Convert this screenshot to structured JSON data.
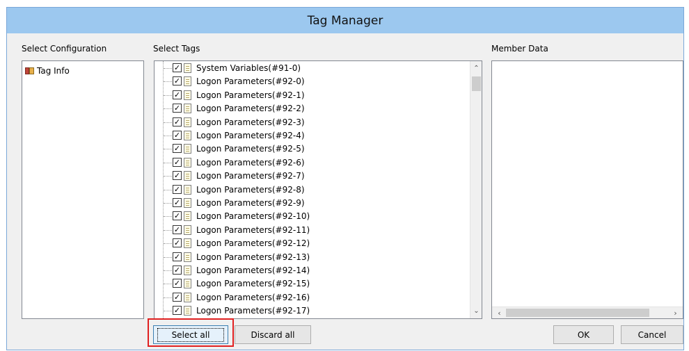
{
  "window": {
    "title": "Tag Manager"
  },
  "labels": {
    "select_configuration": "Select Configuration",
    "select_tags": "Select Tags",
    "member_data": "Member Data"
  },
  "configuration": {
    "items": [
      {
        "label": "Tag Info",
        "icon": "book-icon"
      }
    ]
  },
  "tags": {
    "items": [
      {
        "label": "System Variables(#91-0)",
        "checked": true
      },
      {
        "label": "Logon Parameters(#92-0)",
        "checked": true
      },
      {
        "label": "Logon Parameters(#92-1)",
        "checked": true
      },
      {
        "label": "Logon Parameters(#92-2)",
        "checked": true
      },
      {
        "label": "Logon Parameters(#92-3)",
        "checked": true
      },
      {
        "label": "Logon Parameters(#92-4)",
        "checked": true
      },
      {
        "label": "Logon Parameters(#92-5)",
        "checked": true
      },
      {
        "label": "Logon Parameters(#92-6)",
        "checked": true
      },
      {
        "label": "Logon Parameters(#92-7)",
        "checked": true
      },
      {
        "label": "Logon Parameters(#92-8)",
        "checked": true
      },
      {
        "label": "Logon Parameters(#92-9)",
        "checked": true
      },
      {
        "label": "Logon Parameters(#92-10)",
        "checked": true
      },
      {
        "label": "Logon Parameters(#92-11)",
        "checked": true
      },
      {
        "label": "Logon Parameters(#92-12)",
        "checked": true
      },
      {
        "label": "Logon Parameters(#92-13)",
        "checked": true
      },
      {
        "label": "Logon Parameters(#92-14)",
        "checked": true
      },
      {
        "label": "Logon Parameters(#92-15)",
        "checked": true
      },
      {
        "label": "Logon Parameters(#92-16)",
        "checked": true
      },
      {
        "label": "Logon Parameters(#92-17)",
        "checked": true
      }
    ]
  },
  "buttons": {
    "select_all": "Select all",
    "discard_all": "Discard all",
    "ok": "OK",
    "cancel": "Cancel"
  },
  "colors": {
    "titlebar": "#9cc8ef",
    "highlight": "#e02020",
    "focus_border": "#3c7fb1"
  }
}
